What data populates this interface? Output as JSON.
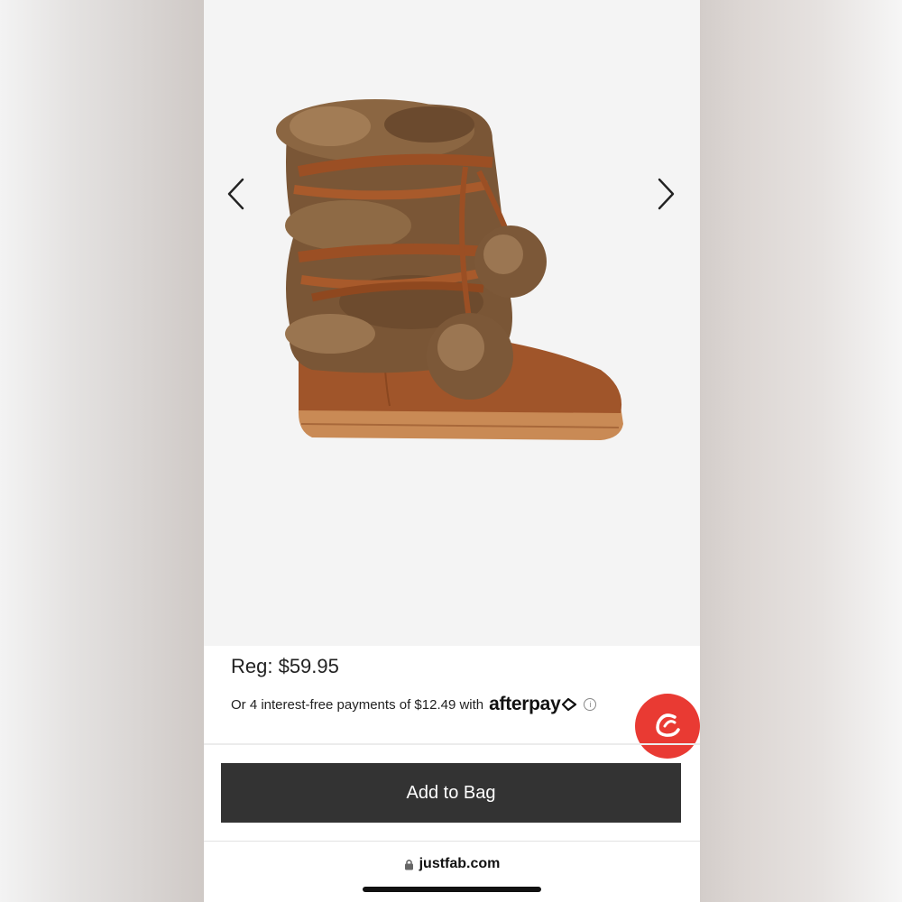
{
  "product": {
    "image_alt": "Cognac faux-fur wrap boot with pom-poms",
    "price_label": "Reg: $59.95",
    "installments_text": "Or 4 interest-free payments of $12.49 with",
    "afterpay_brand": "afterpay"
  },
  "actions": {
    "add_to_bag": "Add to Bag"
  },
  "browser": {
    "url": "justfab.com"
  },
  "colors": {
    "button_bg": "#333333",
    "chat_bubble": "#e93a33",
    "boot_suede": "#a0552a"
  },
  "icons": {
    "prev": "chevron-left-icon",
    "next": "chevron-right-icon",
    "chat": "chat-logo-icon",
    "lock": "lock-icon",
    "info": "info-icon"
  }
}
